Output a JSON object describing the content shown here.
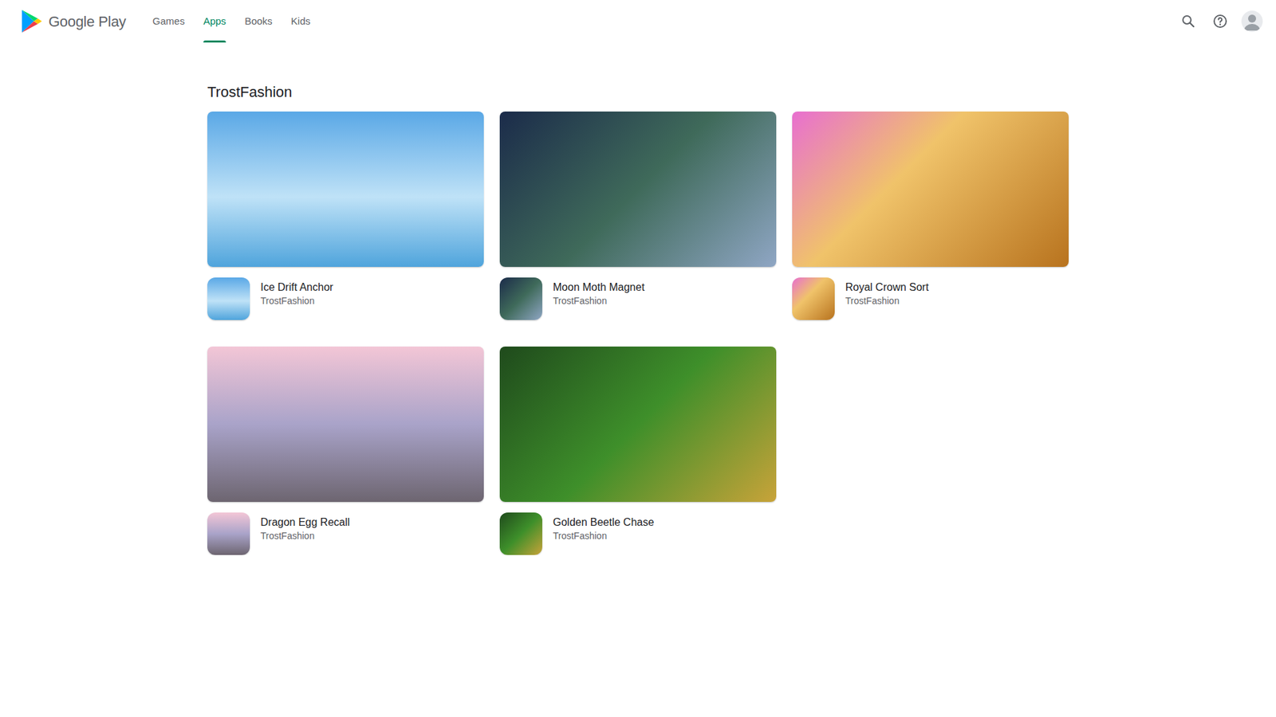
{
  "header": {
    "logo": "Google Play",
    "tabs": [
      {
        "label": "Games",
        "selected": false
      },
      {
        "label": "Apps",
        "selected": true
      },
      {
        "label": "Books",
        "selected": false
      },
      {
        "label": "Kids",
        "selected": false
      }
    ]
  },
  "page": {
    "title": "TrostFashion"
  },
  "apps": [
    {
      "name": "Ice Drift Anchor",
      "developer": "TrostFashion"
    },
    {
      "name": "Moon Moth Magnet",
      "developer": "TrostFashion"
    },
    {
      "name": "Royal Crown Sort",
      "developer": "TrostFashion"
    },
    {
      "name": "Dragon Egg Recall",
      "developer": "TrostFashion"
    },
    {
      "name": "Golden Beetle Chase",
      "developer": "TrostFashion"
    }
  ]
}
